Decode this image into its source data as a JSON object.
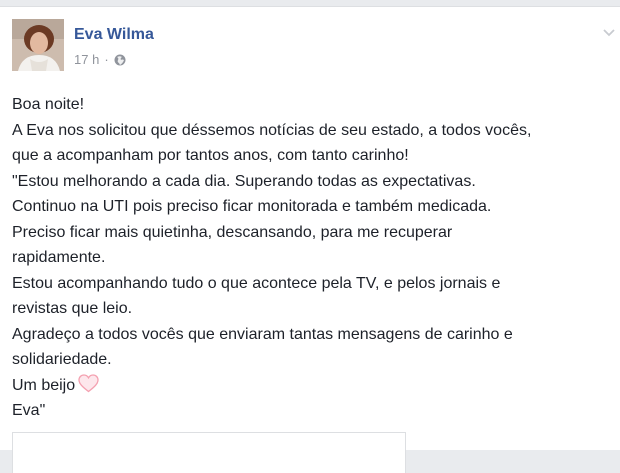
{
  "post": {
    "author": "Eva Wilma",
    "time": "17 h",
    "separator": "·",
    "privacy_icon": "globe-icon",
    "menu_icon": "chevron-down-icon",
    "lines": [
      "Boa noite!",
      "A Eva nos solicitou que déssemos notícias de seu estado, a todos vocês,",
      "que a acompanham por tantos anos, com tanto carinho!",
      "\"Estou melhorando a cada dia. Superando todas as expectativas.",
      "Continuo na UTI pois preciso ficar monitorada e também medicada.",
      "Preciso ficar mais quietinha, descansando, para me recuperar",
      "rapidamente.",
      "Estou acompanhando tudo o que acontece pela TV, e pelos jornais e",
      "revistas que leio.",
      "Agradeço a todos vocês que enviaram tantas mensagens de carinho e",
      "solidariedade.",
      "Um beijo",
      "Eva\""
    ],
    "heart_icon": "heart-icon"
  },
  "colors": {
    "author": "#365899",
    "text": "#1d2129",
    "meta": "#90949c",
    "heart": "#f4a0b0"
  }
}
